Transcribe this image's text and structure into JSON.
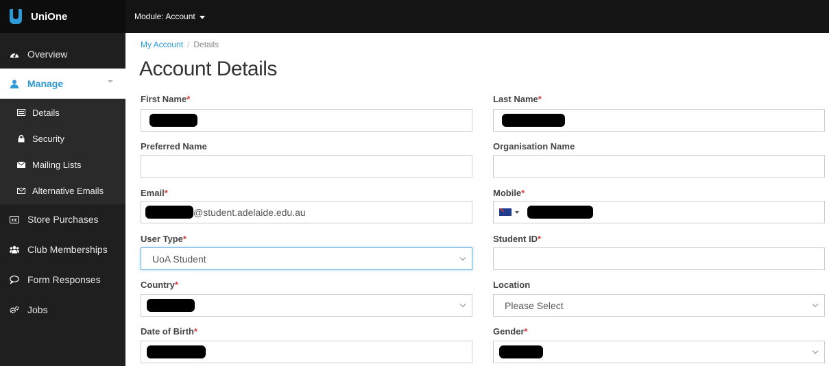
{
  "app": {
    "name": "UniOne",
    "module_label": "Module: Account"
  },
  "sidebar": {
    "overview": "Overview",
    "manage": "Manage",
    "manage_items": [
      "Details",
      "Security",
      "Mailing Lists",
      "Alternative Emails"
    ],
    "store_purchases": "Store Purchases",
    "club_memberships": "Club Memberships",
    "form_responses": "Form Responses",
    "jobs": "Jobs"
  },
  "breadcrumb": {
    "parent": "My Account",
    "separator": "/",
    "current": "Details"
  },
  "page": {
    "title": "Account Details"
  },
  "form": {
    "first_name": {
      "label": "First Name",
      "required": "*"
    },
    "last_name": {
      "label": "Last Name",
      "required": "*"
    },
    "preferred_name": {
      "label": "Preferred Name",
      "value": ""
    },
    "organisation_name": {
      "label": "Organisation Name",
      "value": ""
    },
    "email": {
      "label": "Email",
      "required": "*",
      "domain": "@student.adelaide.edu.au"
    },
    "mobile": {
      "label": "Mobile",
      "required": "*"
    },
    "user_type": {
      "label": "User Type",
      "required": "*",
      "selected": "UoA Student"
    },
    "student_id": {
      "label": "Student ID",
      "required": "*",
      "value": ""
    },
    "country": {
      "label": "Country",
      "required": "*"
    },
    "location": {
      "label": "Location",
      "selected": "Please Select"
    },
    "date_of_birth": {
      "label": "Date of Birth",
      "required": "*"
    },
    "gender": {
      "label": "Gender",
      "required": "*"
    }
  },
  "colors": {
    "accent": "#2d9ad8",
    "required": "#d43a3a",
    "sidebar_bg": "#1f1f1f",
    "topbar_bg": "#141414"
  }
}
